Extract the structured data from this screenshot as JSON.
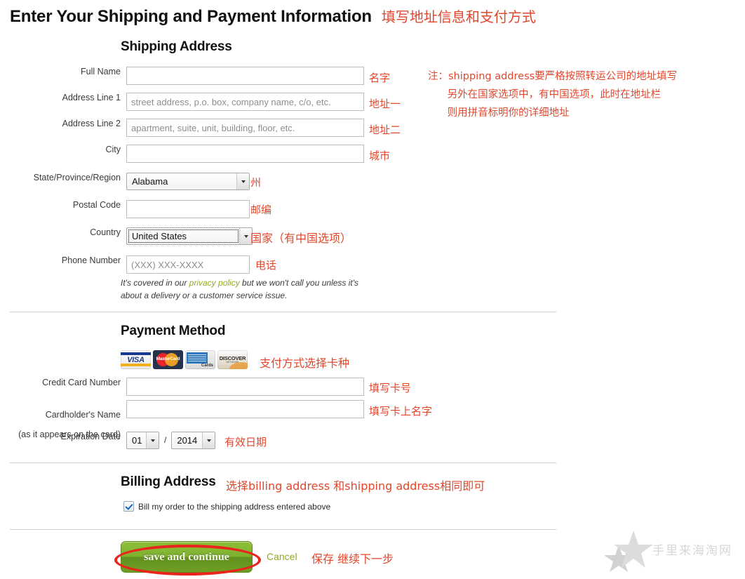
{
  "page": {
    "title": "Enter Your Shipping and Payment Information",
    "title_note_zh": "填写地址信息和支付方式",
    "side_note_zh": "注：shipping address要严格按照转运公司的地址填写\n      另外在国家选项中，有中国选项，此时在地址栏\n      则用拼音标明你的详细地址",
    "accent_red": "#e2472c",
    "link_green": "#94a822",
    "button_green": "#7db22e"
  },
  "shipping": {
    "heading": "Shipping Address",
    "fields": [
      {
        "label": "Full Name",
        "value": "",
        "placeholder": "",
        "note_zh": "名字"
      },
      {
        "label": "Address Line 1",
        "value": "",
        "placeholder": "street address, p.o. box, company name, c/o, etc.",
        "note_zh": "地址一"
      },
      {
        "label": "Address Line 2",
        "value": "",
        "placeholder": "apartment, suite, unit, building, floor, etc.",
        "note_zh": "地址二"
      },
      {
        "label": "City",
        "value": "",
        "placeholder": "",
        "note_zh": "城市"
      }
    ],
    "state": {
      "label": "State/Province/Region",
      "value": "Alabama",
      "note_zh": "州"
    },
    "postal": {
      "label": "Postal Code",
      "value": "",
      "placeholder": "",
      "note_zh": "邮编"
    },
    "country": {
      "label": "Country",
      "value": "United States",
      "note_zh": "国家（有中国选项）"
    },
    "phone": {
      "label": "Phone Number",
      "value": "",
      "placeholder": "(XXX) XXX-XXXX",
      "note_zh": "电话"
    },
    "privacy": {
      "before": "It's covered in our ",
      "link": "privacy policy",
      "after": " but we won't call you unless it's about a delivery or a customer service issue."
    }
  },
  "payment": {
    "heading": "Payment Method",
    "cards": [
      "VISA",
      "MasterCard",
      "American Express",
      "DISCOVER"
    ],
    "cards_note_zh": "支付方式选择卡种",
    "card_number": {
      "label": "Credit Card Number",
      "value": "",
      "note_zh": "填写卡号"
    },
    "cardholder": {
      "label_line1": "Cardholder's Name",
      "label_line2": "(as it appears on the card)",
      "value": "",
      "note_zh": "填写卡上名字"
    },
    "expiration": {
      "label": "Expiration Date",
      "month": "01",
      "separator": "/",
      "year": "2014",
      "note_zh": "有效日期"
    }
  },
  "billing": {
    "heading": "Billing Address",
    "note_zh": "选择billing address 和shipping address相同即可",
    "checkbox_label": "Bill my order to the shipping address entered above",
    "checkbox_checked": true
  },
  "footer": {
    "save_label": "save and continue",
    "cancel_label": "Cancel",
    "note_zh": "保存 继续下一步"
  },
  "watermark": {
    "text": "手里来海淘网"
  }
}
